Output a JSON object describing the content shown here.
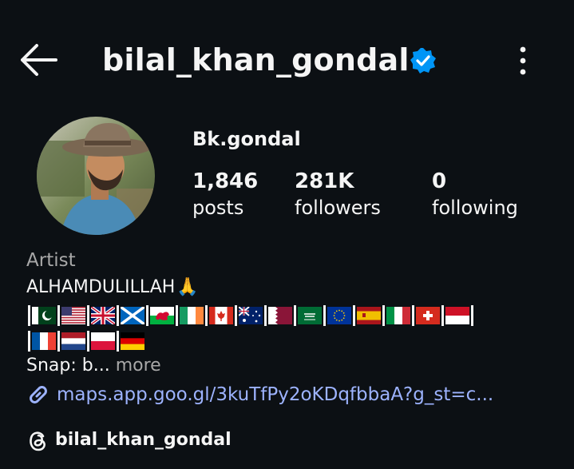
{
  "header": {
    "username": "bilal_khan_gondal",
    "back_icon": "arrow-left-icon",
    "verified_icon": "verified-badge-icon",
    "menu_icon": "kebab-menu-icon"
  },
  "profile": {
    "display_name": "Bk.gondal",
    "stats": [
      {
        "value": "1,846",
        "label": "posts"
      },
      {
        "value": "281K",
        "label": "followers"
      },
      {
        "value": "0",
        "label": "following"
      }
    ]
  },
  "bio": {
    "category": "Artist",
    "line1": "ALHAMDULILLAH",
    "line1_emoji": "🙏",
    "flags_row1": [
      "PK",
      "US",
      "GB",
      "SCT",
      "WLS",
      "IE",
      "CA",
      "AU",
      "QA",
      "SA",
      "EU",
      "ES",
      "IT",
      "CH",
      "ID"
    ],
    "flags_row2": [
      "FR",
      "NL",
      "PL",
      "DE"
    ],
    "snap_text": "Snap: b...",
    "more_label": "more",
    "link_text": "maps.app.goo.gl/3kuTfPy2oKDqfbbaA?g_st=c..."
  },
  "threads": {
    "handle": "bilal_khan_gondal",
    "icon": "threads-icon"
  },
  "colors": {
    "background": "#0c1014",
    "verified": "#0095f6",
    "link": "#9db3ff",
    "muted": "#a8a8a8"
  }
}
